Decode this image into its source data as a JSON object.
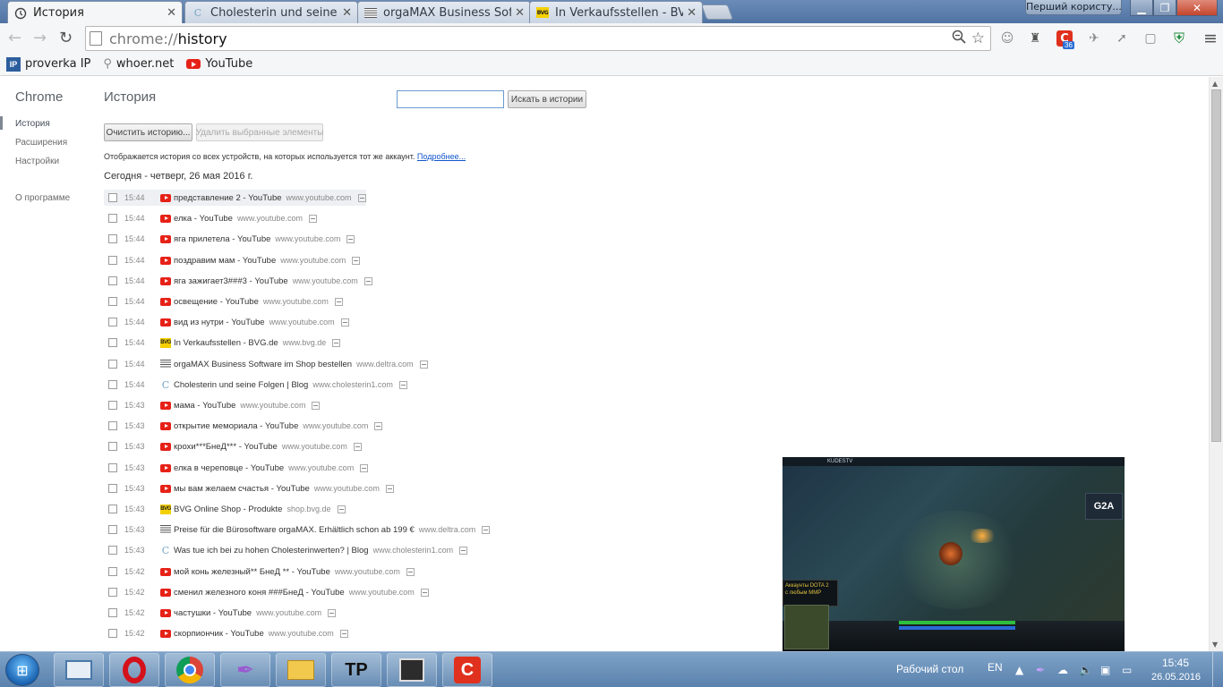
{
  "browser": {
    "tabs": [
      {
        "title": "История",
        "favicon": "history-icon",
        "active": true
      },
      {
        "title": "Cholesterin und seine Folg",
        "favicon": "c-icon",
        "active": false
      },
      {
        "title": "orgaMAX Business Softwa",
        "favicon": "lines-icon",
        "active": false
      },
      {
        "title": "In Verkaufsstellen - BVG.d",
        "favicon": "bvg-icon",
        "active": false
      }
    ],
    "profile_name": "Перший користу...",
    "address": {
      "scheme": "chrome://",
      "host": "history"
    },
    "bookmarks": [
      {
        "label": "proverka IP",
        "icon": "ip-icon"
      },
      {
        "label": "whoer.net",
        "icon": "search-icon"
      },
      {
        "label": "YouTube",
        "icon": "youtube-icon"
      }
    ],
    "extension_badge": "36"
  },
  "sidebar": {
    "title": "Chrome",
    "items": [
      {
        "label": "История",
        "selected": true
      },
      {
        "label": "Расширения",
        "selected": false
      },
      {
        "label": "Настройки",
        "selected": false
      },
      {
        "label": "О программе",
        "selected": false
      }
    ]
  },
  "history": {
    "title": "История",
    "search_button": "Искать в истории",
    "search_value": "",
    "clear_button": "Очистить историю...",
    "remove_button": "Удалить выбранные элементы",
    "notice_text": "Отображается история со всех устройств, на которых используется тот же аккаунт.",
    "notice_link": "Подробнее...",
    "day_header": "Сегодня - четверг, 26 мая 2016 г.",
    "entries": [
      {
        "time": "15:44",
        "icon": "youtube",
        "title": "представление 2 - YouTube",
        "domain": "www.youtube.com"
      },
      {
        "time": "15:44",
        "icon": "youtube",
        "title": "елка - YouTube",
        "domain": "www.youtube.com"
      },
      {
        "time": "15:44",
        "icon": "youtube",
        "title": "яга прилетела - YouTube",
        "domain": "www.youtube.com"
      },
      {
        "time": "15:44",
        "icon": "youtube",
        "title": "поздравим мам - YouTube",
        "domain": "www.youtube.com"
      },
      {
        "time": "15:44",
        "icon": "youtube",
        "title": "яга зажигает3###3 - YouTube",
        "domain": "www.youtube.com"
      },
      {
        "time": "15:44",
        "icon": "youtube",
        "title": "освещение - YouTube",
        "domain": "www.youtube.com"
      },
      {
        "time": "15:44",
        "icon": "youtube",
        "title": "вид из нутри - YouTube",
        "domain": "www.youtube.com"
      },
      {
        "time": "15:44",
        "icon": "bvg",
        "title": "In Verkaufsstellen - BVG.de",
        "domain": "www.bvg.de"
      },
      {
        "time": "15:44",
        "icon": "lines",
        "title": "orgaMAX Business Software im Shop bestellen",
        "domain": "www.deltra.com"
      },
      {
        "time": "15:44",
        "icon": "c",
        "title": "Cholesterin und seine Folgen | Blog",
        "domain": "www.cholesterin1.com"
      },
      {
        "time": "15:43",
        "icon": "youtube",
        "title": "мама - YouTube",
        "domain": "www.youtube.com"
      },
      {
        "time": "15:43",
        "icon": "youtube",
        "title": "открытие мемориала - YouTube",
        "domain": "www.youtube.com"
      },
      {
        "time": "15:43",
        "icon": "youtube",
        "title": "крохи***БнеД*** - YouTube",
        "domain": "www.youtube.com"
      },
      {
        "time": "15:43",
        "icon": "youtube",
        "title": "елка в череповце - YouTube",
        "domain": "www.youtube.com"
      },
      {
        "time": "15:43",
        "icon": "youtube",
        "title": "мы вам желаем счастья - YouTube",
        "domain": "www.youtube.com"
      },
      {
        "time": "15:43",
        "icon": "bvg",
        "title": "BVG Online Shop - Produkte",
        "domain": "shop.bvg.de"
      },
      {
        "time": "15:43",
        "icon": "lines",
        "title": "Preise für die Bürosoftware orgaMAX. Erhältlich schon ab 199 €",
        "domain": "www.deltra.com"
      },
      {
        "time": "15:43",
        "icon": "c",
        "title": "Was tue ich bei zu hohen Cholesterinwerten? | Blog",
        "domain": "www.cholesterin1.com"
      },
      {
        "time": "15:42",
        "icon": "youtube",
        "title": "мой конь железный** БнеД ** - YouTube",
        "domain": "www.youtube.com"
      },
      {
        "time": "15:42",
        "icon": "youtube",
        "title": "сменил железного коня ###БнеД - YouTube",
        "domain": "www.youtube.com"
      },
      {
        "time": "15:42",
        "icon": "youtube",
        "title": "частушки - YouTube",
        "domain": "www.youtube.com"
      },
      {
        "time": "15:42",
        "icon": "youtube",
        "title": "скорпиончик - YouTube",
        "domain": "www.youtube.com"
      }
    ]
  },
  "video_overlay": {
    "channel": "KUDESTV",
    "ad_text_1": "Аккаунты DOTA 2",
    "ad_text_2": "с любым ММР",
    "logo": "G2A"
  },
  "taskbar": {
    "apps": [
      "explorer-window",
      "opera",
      "chrome",
      "feather",
      "file-manager",
      "tp",
      "media-center",
      "c-app"
    ],
    "desktop_label": "Рабочий стол",
    "language": "EN",
    "time": "15:45",
    "date": "26.05.2016"
  },
  "colors": {
    "titlebar": "#5a7eac",
    "youtube_red": "#e62117",
    "link": "#1155cc",
    "bvg_yellow": "#f5d000"
  }
}
